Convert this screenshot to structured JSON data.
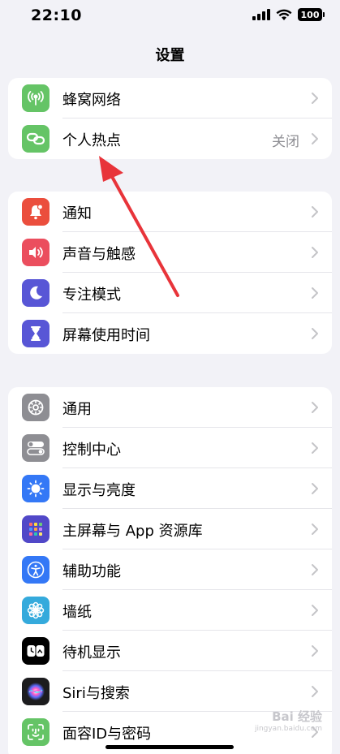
{
  "status_bar": {
    "time": "22:10",
    "battery": "100"
  },
  "nav": {
    "title": "设置"
  },
  "groups": [
    {
      "items": [
        {
          "label": "蜂窝网络",
          "icon": "cellular-antenna-icon",
          "color": "#65c466"
        },
        {
          "label": "个人热点",
          "icon": "hotspot-link-icon",
          "color": "#65c466",
          "value": "关闭"
        }
      ]
    },
    {
      "items": [
        {
          "label": "通知",
          "icon": "notification-bell-icon",
          "color": "#eb4e3d"
        },
        {
          "label": "声音与触感",
          "icon": "speaker-icon",
          "color": "#eb4e5e"
        },
        {
          "label": "专注模式",
          "icon": "moon-icon",
          "color": "#5856d6"
        },
        {
          "label": "屏幕使用时间",
          "icon": "hourglass-icon",
          "color": "#5856d6"
        }
      ]
    },
    {
      "items": [
        {
          "label": "通用",
          "icon": "gear-icon",
          "color": "#8e8e93"
        },
        {
          "label": "控制中心",
          "icon": "toggles-icon",
          "color": "#8e8e93"
        },
        {
          "label": "显示与亮度",
          "icon": "sun-icon",
          "color": "#3478f6"
        },
        {
          "label": "主屏幕与 App 资源库",
          "icon": "app-grid-icon",
          "color": "#5148c8"
        },
        {
          "label": "辅助功能",
          "icon": "accessibility-person-icon",
          "color": "#3478f6"
        },
        {
          "label": "墙纸",
          "icon": "flower-icon",
          "color": "#35aadc"
        },
        {
          "label": "待机显示",
          "icon": "standby-icon",
          "color": "#000000"
        },
        {
          "label": "Siri与搜索",
          "icon": "siri-orb-icon",
          "color": "#1c1c1e"
        },
        {
          "label": "面容ID与密码",
          "icon": "face-id-icon",
          "color": "#65c466"
        }
      ]
    }
  ],
  "watermark": {
    "brand": "Bai 经验",
    "url": "jingyan.baidu.com"
  },
  "annotation": {
    "color": "#e8343a"
  }
}
